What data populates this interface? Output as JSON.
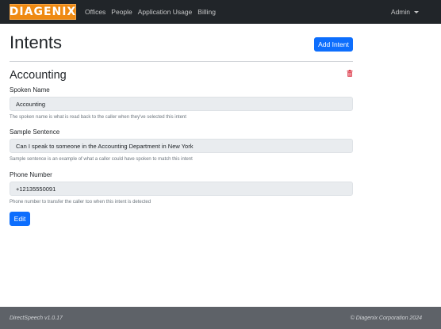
{
  "navbar": {
    "logo_text": "DIAGENIX",
    "links": [
      {
        "label": "Offices"
      },
      {
        "label": "People"
      },
      {
        "label": "Application Usage"
      },
      {
        "label": "Billing"
      }
    ],
    "user_menu_label": "Admin"
  },
  "page": {
    "title": "Intents",
    "add_button_label": "Add Intent"
  },
  "intent": {
    "name": "Accounting",
    "fields": [
      {
        "label": "Spoken Name",
        "value": "Accounting",
        "help": "The spoken name is what is read back to the caller when they've selected this intent"
      },
      {
        "label": "Sample Sentence",
        "value": "Can I speak to someone in the Accounting Department in New York",
        "help": "Sample sentence is an example of what a caller could have spoken to match this intent"
      },
      {
        "label": "Phone Number",
        "value": "+12135550091",
        "help": "Phone number to transfer the caller too when this intent is detected"
      }
    ],
    "edit_button_label": "Edit"
  },
  "footer": {
    "version": "DirectSpeech v1.0.17",
    "copyright": "© Diagenix Corporation 2024"
  },
  "colors": {
    "navbar_bg": "#212529",
    "logo_bg": "#ef8a12",
    "primary": "#0d6efd",
    "danger": "#dc3545",
    "footer_bg": "#5e6268"
  },
  "icons": {
    "delete": "trash-icon",
    "user_menu": "caret-down-icon"
  }
}
